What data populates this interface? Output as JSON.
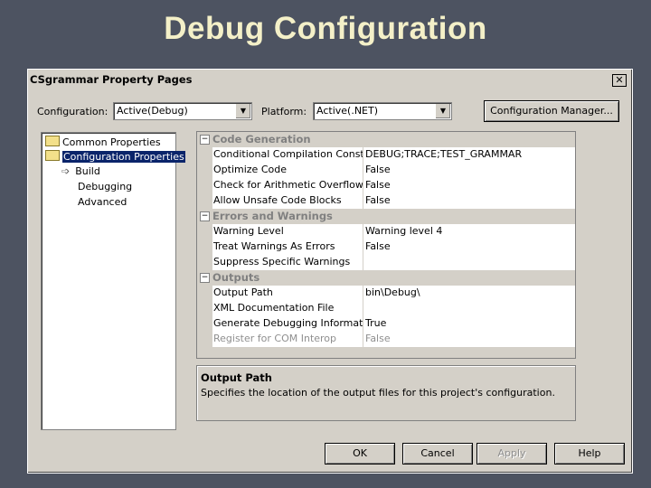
{
  "slide": {
    "title": "Debug Configuration"
  },
  "dialog": {
    "title": "CSgrammar Property Pages",
    "close_label": "✕",
    "configuration_label": "Configuration:",
    "configuration_value": "Active(Debug)",
    "platform_label": "Platform:",
    "platform_value": "Active(.NET)",
    "config_manager_label": "Configuration Manager..."
  },
  "tree": {
    "items": [
      {
        "label": "Common Properties"
      },
      {
        "label": "Configuration Properties"
      },
      {
        "label": "Build"
      },
      {
        "label": "Debugging"
      },
      {
        "label": "Advanced"
      }
    ]
  },
  "grid": {
    "categories": [
      {
        "title": "Code Generation",
        "toggle": "−"
      },
      {
        "title": "Errors and Warnings",
        "toggle": "−"
      },
      {
        "title": "Outputs",
        "toggle": "−"
      }
    ],
    "rows": [
      {
        "name": "Conditional Compilation Constants",
        "value": "DEBUG;TRACE;TEST_GRAMMAR"
      },
      {
        "name": "Optimize Code",
        "value": "False"
      },
      {
        "name": "Check for Arithmetic Overflow/Underflow",
        "value": "False"
      },
      {
        "name": "Allow Unsafe Code Blocks",
        "value": "False"
      },
      {
        "name": "Warning Level",
        "value": "Warning level 4"
      },
      {
        "name": "Treat Warnings As Errors",
        "value": "False"
      },
      {
        "name": "Suppress Specific Warnings",
        "value": ""
      },
      {
        "name": "Output Path",
        "value": "bin\\Debug\\"
      },
      {
        "name": "XML Documentation File",
        "value": ""
      },
      {
        "name": "Generate Debugging Information",
        "value": "True"
      },
      {
        "name": "Register for COM Interop",
        "value": "False"
      }
    ]
  },
  "description": {
    "title": "Output Path",
    "text": "Specifies the location of the output files for this project's configuration."
  },
  "buttons": {
    "ok": "OK",
    "cancel": "Cancel",
    "apply": "Apply",
    "help": "Help"
  },
  "colors": {
    "slide_bg": "#4d5361",
    "title_text": "#f4f0c8",
    "dialog_bg": "#d4d0c8",
    "selection": "#0a246a"
  }
}
